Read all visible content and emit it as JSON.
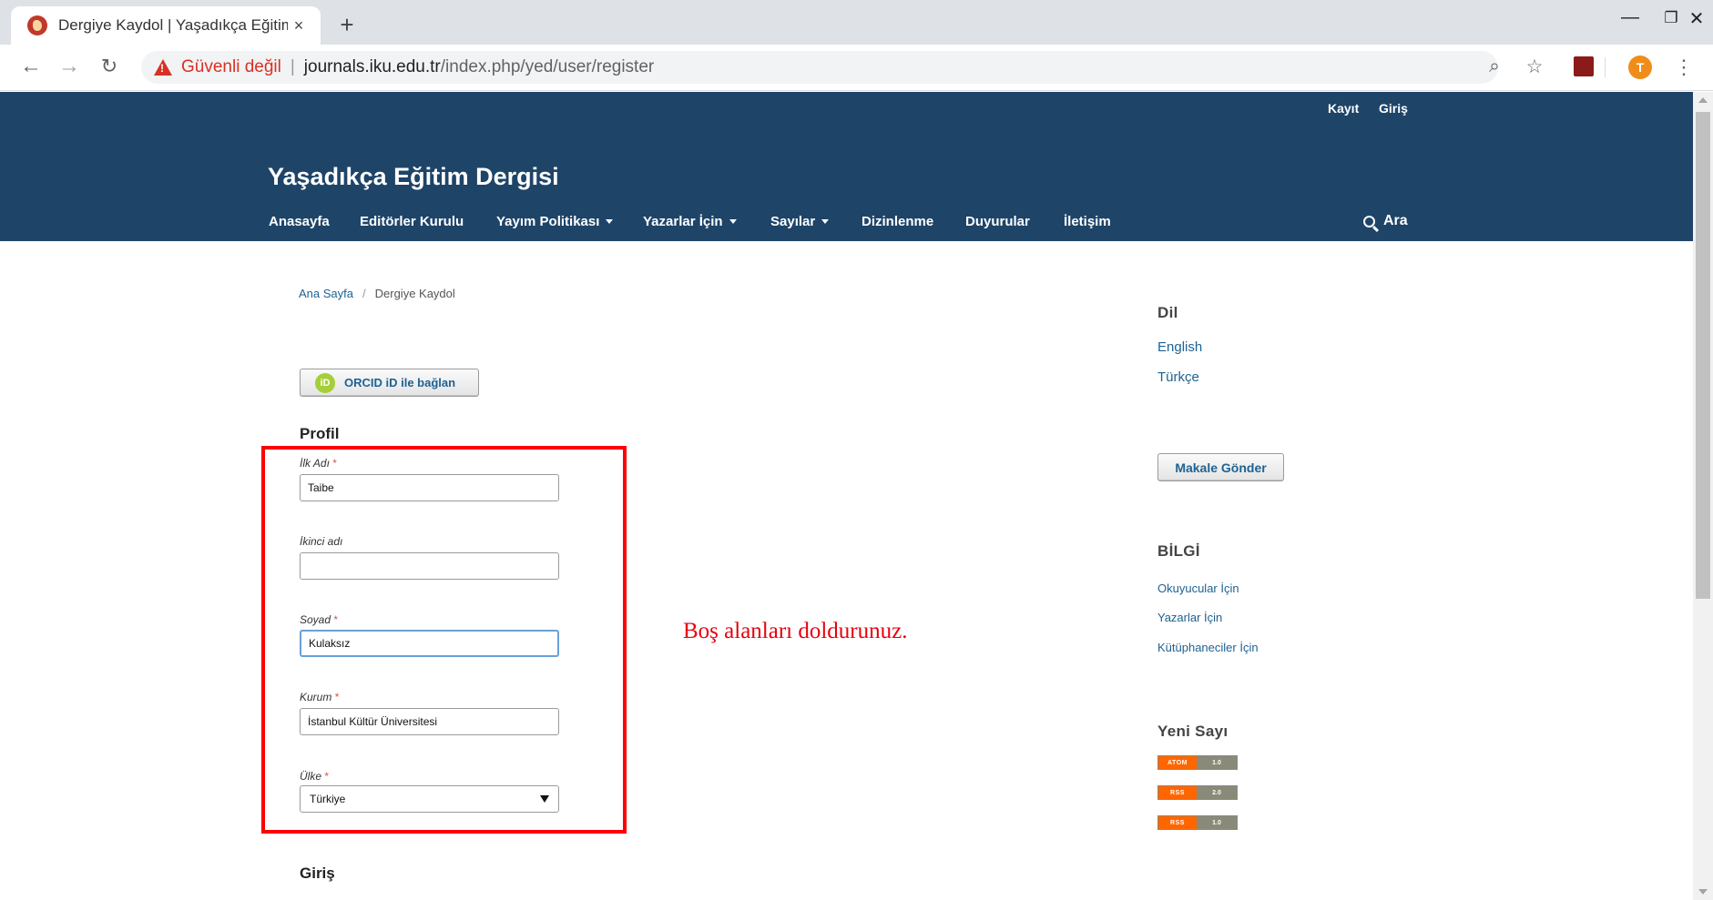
{
  "browser": {
    "tab_title": "Dergiye Kaydol | Yaşadıkça Eğitim",
    "tab_close": "×",
    "new_tab": "+",
    "security_label": "Güvenli değil",
    "url_host": "journals.iku.edu.tr",
    "url_path": "/index.php/yed/user/register",
    "profile_initial": "T"
  },
  "header": {
    "user_nav": {
      "register": "Kayıt",
      "login": "Giriş"
    },
    "site_title": "Yaşadıkça Eğitim Dergisi",
    "nav": [
      {
        "label": "Anasayfa",
        "dropdown": false
      },
      {
        "label": "Editörler Kurulu",
        "dropdown": false
      },
      {
        "label": "Yayım Politikası",
        "dropdown": true
      },
      {
        "label": "Yazarlar İçin",
        "dropdown": true
      },
      {
        "label": "Sayılar",
        "dropdown": true
      },
      {
        "label": "Dizinlenme",
        "dropdown": false
      },
      {
        "label": "Duyurular",
        "dropdown": false
      },
      {
        "label": "İletişim",
        "dropdown": false
      }
    ],
    "search_label": "Ara"
  },
  "breadcrumb": {
    "home": "Ana Sayfa",
    "separator": "/",
    "current": "Dergiye Kaydol"
  },
  "orcid": {
    "icon_text": "iD",
    "label": "ORCID iD ile bağlan"
  },
  "profile": {
    "title": "Profil",
    "required_mark": "*",
    "fields": {
      "first_name": {
        "label": "İlk Adı",
        "value": "Taibe",
        "required": true
      },
      "middle_name": {
        "label": "İkinci adı",
        "value": "",
        "required": false
      },
      "last_name": {
        "label": "Soyad",
        "value": "Kulaksız",
        "required": true
      },
      "affiliation": {
        "label": "Kurum",
        "value": "İstanbul Kültür Üniversitesi",
        "required": true
      },
      "country": {
        "label": "Ülke",
        "value": "Türkiye",
        "required": true
      }
    }
  },
  "annotation": "Boş alanları doldurunuz.",
  "login_section_title": "Giriş",
  "sidebar": {
    "language": {
      "title": "Dil",
      "items": [
        "English",
        "Türkçe"
      ]
    },
    "submit_label": "Makale Gönder",
    "info": {
      "title": "BİLGİ",
      "items": [
        "Okuyucular İçin",
        "Yazarlar İçin",
        "Kütüphaneciler İçin"
      ]
    },
    "new_issue": {
      "title": "Yeni Sayı",
      "feeds": [
        {
          "type": "ATOM",
          "version": "1.0"
        },
        {
          "type": "RSS",
          "version": "2.0"
        },
        {
          "type": "RSS",
          "version": "1.0"
        }
      ]
    }
  },
  "colors": {
    "header_bg": "#1e4468",
    "link": "#1e6292",
    "annotation": "#e8000b",
    "highlight_border": "#ff0000",
    "required": "#d9534f"
  }
}
